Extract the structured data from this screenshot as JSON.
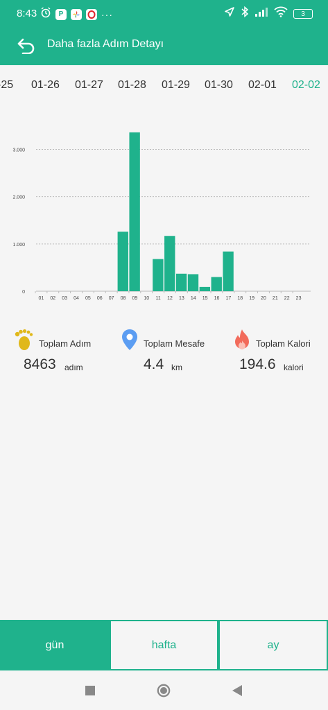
{
  "status": {
    "time": "8:43",
    "battery": "3"
  },
  "appbar": {
    "title": "Daha fazla Adım Detayı"
  },
  "dates": [
    "-25",
    "01-26",
    "01-27",
    "01-28",
    "01-29",
    "01-30",
    "02-01",
    "02-02"
  ],
  "active_date": "02-02",
  "chart_data": {
    "type": "bar",
    "categories": [
      "01",
      "02",
      "03",
      "04",
      "05",
      "06",
      "07",
      "08",
      "09",
      "10",
      "11",
      "12",
      "13",
      "14",
      "15",
      "16",
      "17",
      "18",
      "19",
      "20",
      "21",
      "22",
      "23"
    ],
    "values": [
      0,
      0,
      0,
      0,
      0,
      0,
      0,
      1260,
      3360,
      0,
      680,
      1170,
      370,
      360,
      90,
      300,
      840,
      0,
      0,
      0,
      0,
      0,
      0
    ],
    "ylim": [
      0,
      3300
    ],
    "yticks": [
      0,
      1000,
      2000,
      3000
    ],
    "ytick_labels": [
      "0",
      "1.000",
      "2.000",
      "3.000"
    ],
    "grid": true,
    "bar_color": "#1fb28c"
  },
  "stats": {
    "steps": {
      "label": "Toplam Adım",
      "value": "8463",
      "unit": "adım"
    },
    "distance": {
      "label": "Toplam Mesafe",
      "value": "4.4",
      "unit": "km"
    },
    "calories": {
      "label": "Toplam Kalori",
      "value": "194.6",
      "unit": "kalori"
    }
  },
  "tabs": [
    {
      "label": "gün",
      "active": true
    },
    {
      "label": "hafta",
      "active": false
    },
    {
      "label": "ay",
      "active": false
    }
  ],
  "colors": {
    "accent": "#1fb28c"
  }
}
